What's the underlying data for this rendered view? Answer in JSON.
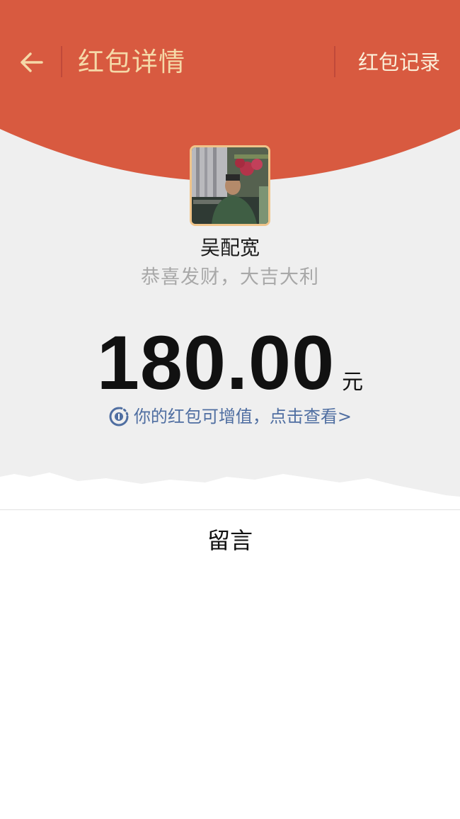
{
  "header": {
    "title": "红包详情",
    "record_link": "红包记录"
  },
  "sender": {
    "name": "吴配宽",
    "greeting": "恭喜发财，大吉大利"
  },
  "amount": {
    "value": "180.00",
    "unit": "元"
  },
  "promo": {
    "text": "你的红包可增值，点击查看>"
  },
  "message": {
    "label": "留言"
  },
  "colors": {
    "header_red": "#d85a40",
    "title_gold": "#f5d9a8",
    "promo_blue": "#4f6ea1",
    "background_gray": "#efefef"
  },
  "icons": [
    "back-arrow-icon",
    "avatar",
    "growth-coin-icon"
  ]
}
